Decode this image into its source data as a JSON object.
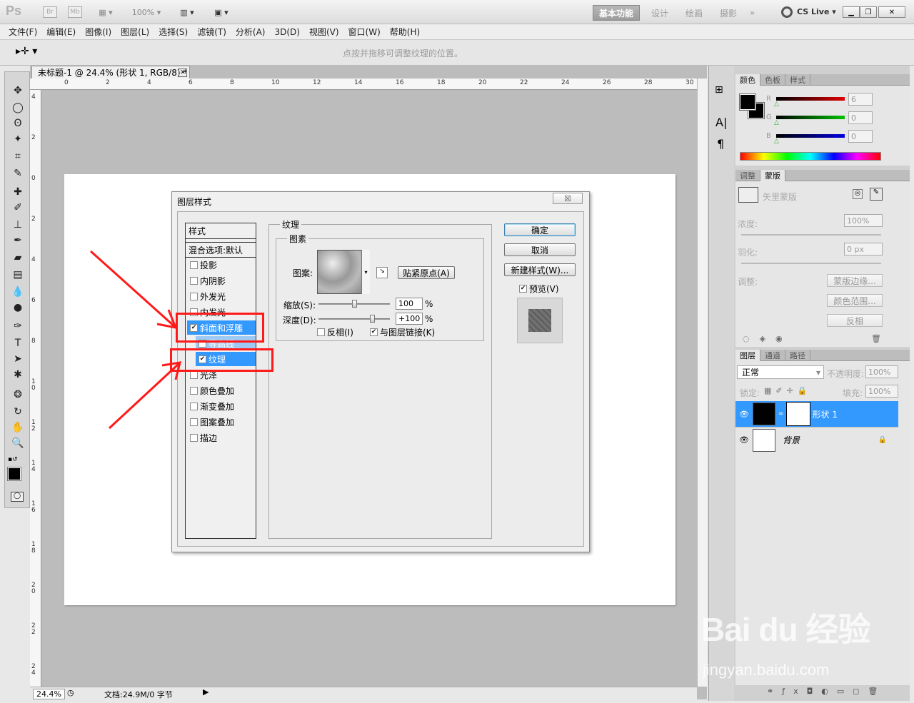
{
  "topbar": {
    "logo": "Ps",
    "br": "Br",
    "mb": "Mb",
    "zoom": "100%",
    "workspaces": [
      "基本功能",
      "设计",
      "绘画",
      "摄影"
    ],
    "more": "»",
    "cslive": "CS Live"
  },
  "menu": [
    "文件(F)",
    "编辑(E)",
    "图像(I)",
    "图层(L)",
    "选择(S)",
    "滤镜(T)",
    "分析(A)",
    "3D(D)",
    "视图(V)",
    "窗口(W)",
    "帮助(H)"
  ],
  "options": {
    "hint": "点按并拖移可调整纹理的位置。"
  },
  "document": {
    "tab_title": "未标题-1 @ 24.4% (形状 1, RGB/8) *",
    "zoom": "24.4%",
    "doc_info": "文档:24.9M/0 字节",
    "hruler": [
      "0",
      "2",
      "4",
      "6",
      "8",
      "10",
      "12",
      "14",
      "16",
      "18",
      "20",
      "22",
      "24",
      "26",
      "28",
      "30"
    ],
    "vruler": [
      "4",
      "2",
      "0",
      "2",
      "4",
      "6",
      "8",
      "1 0",
      "1 2",
      "1 4",
      "1 6",
      "1 8",
      "2 0",
      "2 2",
      "2 4"
    ]
  },
  "dialog": {
    "title": "图层样式",
    "close": "☒",
    "styles_header": "样式",
    "blend_header": "混合选项:默认",
    "styles": [
      {
        "label": "投影",
        "checked": false
      },
      {
        "label": "内阴影",
        "checked": false
      },
      {
        "label": "外发光",
        "checked": false
      },
      {
        "label": "内发光",
        "checked": false
      },
      {
        "label": "斜面和浮雕",
        "checked": true
      },
      {
        "label": "等高线",
        "checked": false
      },
      {
        "label": "纹理",
        "checked": true
      },
      {
        "label": "光泽",
        "checked": false
      },
      {
        "label": "颜色叠加",
        "checked": false
      },
      {
        "label": "渐变叠加",
        "checked": false
      },
      {
        "label": "图案叠加",
        "checked": false
      },
      {
        "label": "描边",
        "checked": false
      }
    ],
    "section_title": "纹理",
    "group_title": "图素",
    "pattern_label": "图案:",
    "snap_button": "贴紧原点(A)",
    "scale_label": "缩放(S):",
    "scale_value": "100",
    "scale_unit": "%",
    "scale_fraction": 0.5,
    "depth_label": "深度(D):",
    "depth_value": "+100",
    "depth_unit": "%",
    "depth_fraction": 0.75,
    "invert_label": "反相(I)",
    "invert_checked": false,
    "link_label": "与图层链接(K)",
    "link_checked": true,
    "ok": "确定",
    "cancel": "取消",
    "new_style": "新建样式(W)...",
    "preview_label": "预览(V)",
    "preview_checked": true
  },
  "color_panel": {
    "tabs": [
      "颜色",
      "色板",
      "样式"
    ],
    "channels": [
      {
        "name": "R",
        "value": "6",
        "color": "#e00000"
      },
      {
        "name": "G",
        "value": "0",
        "color": "#00c000"
      },
      {
        "name": "B",
        "value": "0",
        "color": "#0000e0"
      }
    ]
  },
  "masks_panel": {
    "tabs": [
      "调整",
      "蒙版"
    ],
    "mask_type": "矢里蒙版",
    "density_label": "浓度:",
    "density_value": "100%",
    "feather_label": "羽化:",
    "feather_value": "0 px",
    "adjust_label": "调整:",
    "buttons": [
      "蒙版边缘...",
      "颜色范围...",
      "反相"
    ]
  },
  "layers_panel": {
    "tabs": [
      "图层",
      "通道",
      "路径"
    ],
    "blend_mode": "正常",
    "opacity_label": "不透明度:",
    "opacity": "100%",
    "lock_label": "锁定:",
    "fill_label": "填充:",
    "fill": "100%",
    "layers": [
      {
        "name": "形状 1",
        "selected": true
      },
      {
        "name": "背景",
        "selected": false
      }
    ]
  },
  "watermark": {
    "brand": "Bai du 经验",
    "url": "jingyan.baidu.com"
  }
}
